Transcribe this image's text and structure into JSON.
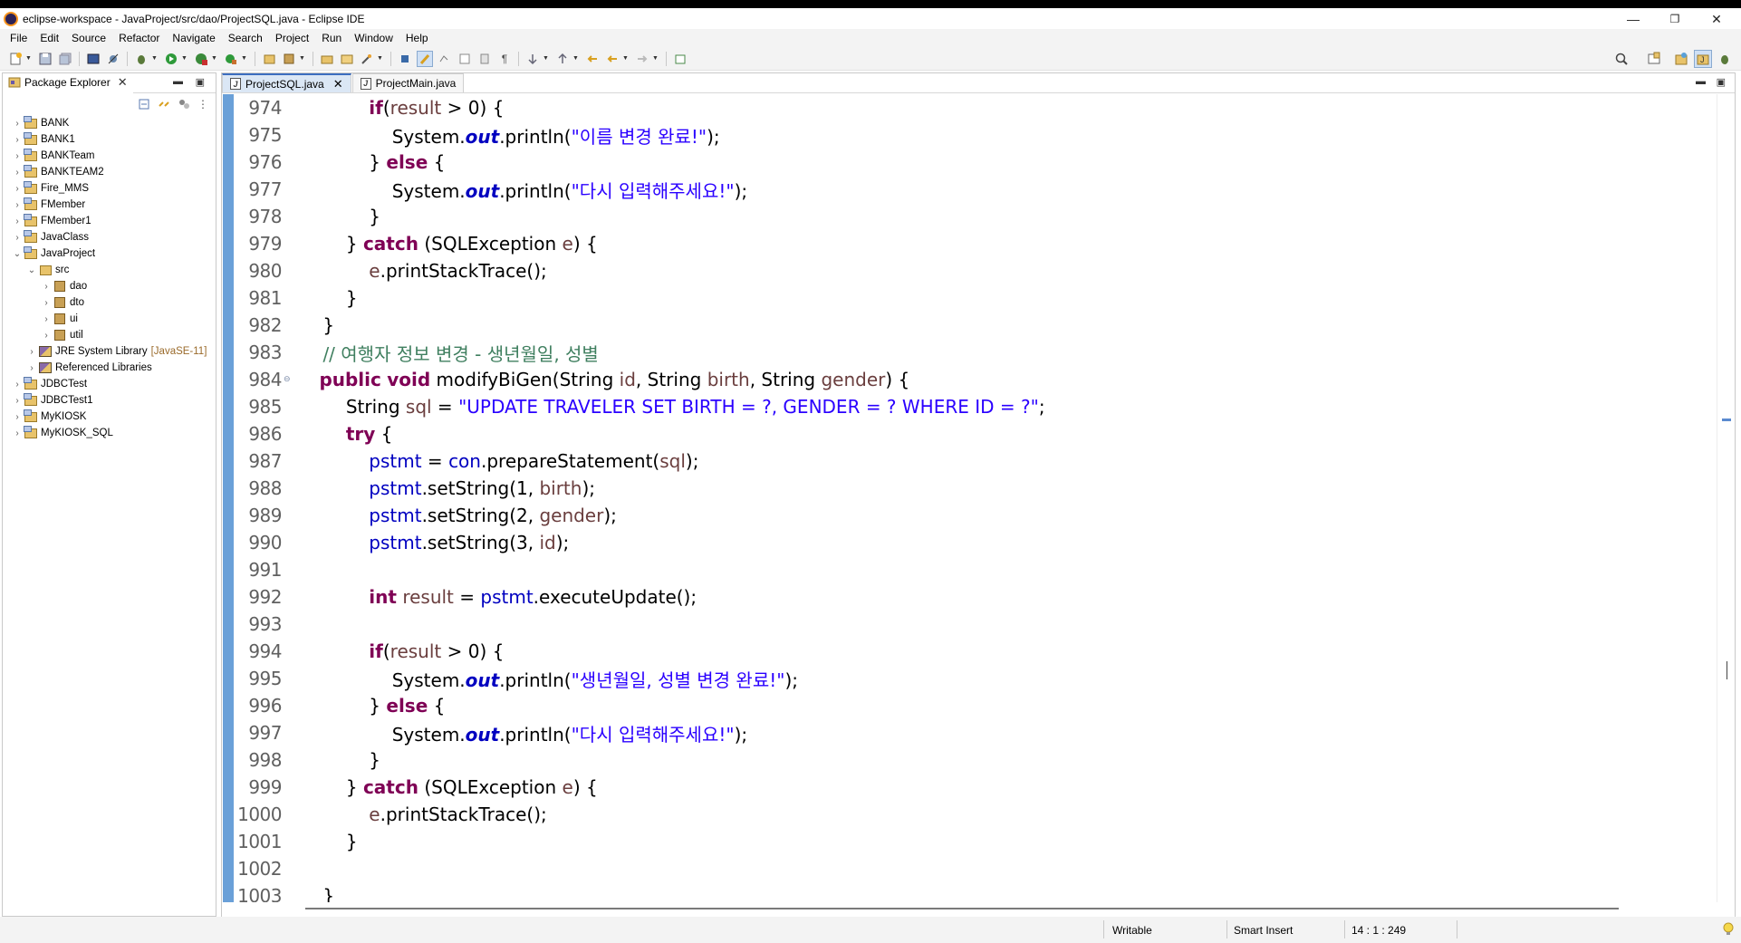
{
  "window": {
    "title": "eclipse-workspace - JavaProject/src/dao/ProjectSQL.java - Eclipse IDE",
    "min_glyph": "—",
    "restore_glyph": "❐",
    "close_glyph": "✕"
  },
  "menu": [
    "File",
    "Edit",
    "Source",
    "Refactor",
    "Navigate",
    "Search",
    "Project",
    "Run",
    "Window",
    "Help"
  ],
  "package_explorer": {
    "title": "Package Explorer",
    "items": [
      {
        "label": "BANK",
        "level": 0,
        "expanded": false,
        "kind": "project"
      },
      {
        "label": "BANK1",
        "level": 0,
        "expanded": false,
        "kind": "project"
      },
      {
        "label": "BANKTeam",
        "level": 0,
        "expanded": false,
        "kind": "project"
      },
      {
        "label": "BANKTEAM2",
        "level": 0,
        "expanded": false,
        "kind": "project"
      },
      {
        "label": "Fire_MMS",
        "level": 0,
        "expanded": false,
        "kind": "project"
      },
      {
        "label": "FMember",
        "level": 0,
        "expanded": false,
        "kind": "project"
      },
      {
        "label": "FMember1",
        "level": 0,
        "expanded": false,
        "kind": "project"
      },
      {
        "label": "JavaClass",
        "level": 0,
        "expanded": false,
        "kind": "project"
      },
      {
        "label": "JavaProject",
        "level": 0,
        "expanded": true,
        "kind": "project"
      },
      {
        "label": "src",
        "level": 1,
        "expanded": true,
        "kind": "src"
      },
      {
        "label": "dao",
        "level": 2,
        "expanded": false,
        "kind": "package"
      },
      {
        "label": "dto",
        "level": 2,
        "expanded": false,
        "kind": "package"
      },
      {
        "label": "ui",
        "level": 2,
        "expanded": false,
        "kind": "package"
      },
      {
        "label": "util",
        "level": 2,
        "expanded": false,
        "kind": "package"
      },
      {
        "label": "JRE System Library",
        "decoration": "[JavaSE-11]",
        "level": 1,
        "expanded": false,
        "kind": "library"
      },
      {
        "label": "Referenced Libraries",
        "level": 1,
        "expanded": false,
        "kind": "library"
      },
      {
        "label": "JDBCTest",
        "level": 0,
        "expanded": false,
        "kind": "project"
      },
      {
        "label": "JDBCTest1",
        "level": 0,
        "expanded": false,
        "kind": "project"
      },
      {
        "label": "MyKIOSK",
        "level": 0,
        "expanded": false,
        "kind": "project"
      },
      {
        "label": "MyKIOSK_SQL",
        "level": 0,
        "expanded": false,
        "kind": "project"
      }
    ]
  },
  "editor": {
    "tabs": [
      {
        "label": "ProjectSQL.java",
        "active": true
      },
      {
        "label": "ProjectMain.java",
        "active": false
      }
    ],
    "lines": [
      {
        "n": "974",
        "code": [
          [
            "",
            "            "
          ],
          [
            "k",
            "if"
          ],
          [
            "",
            "("
          ],
          [
            "v",
            "result"
          ],
          [
            "",
            " > 0) {"
          ]
        ]
      },
      {
        "n": "975",
        "code": [
          [
            "",
            "                System."
          ],
          [
            "f",
            "out"
          ],
          [
            "",
            ".println("
          ],
          [
            "s",
            "\"이름 변경 완료!\""
          ],
          [
            "",
            ");"
          ]
        ]
      },
      {
        "n": "976",
        "code": [
          [
            "",
            "            } "
          ],
          [
            "k",
            "else"
          ],
          [
            "",
            " {"
          ]
        ]
      },
      {
        "n": "977",
        "code": [
          [
            "",
            "                System."
          ],
          [
            "f",
            "out"
          ],
          [
            "",
            ".println("
          ],
          [
            "s",
            "\"다시 입력해주세요!\""
          ],
          [
            "",
            ");"
          ]
        ]
      },
      {
        "n": "978",
        "code": [
          [
            "",
            "            }"
          ]
        ]
      },
      {
        "n": "979",
        "code": [
          [
            "",
            "        } "
          ],
          [
            "k",
            "catch"
          ],
          [
            "",
            " (SQLException "
          ],
          [
            "v",
            "e"
          ],
          [
            "",
            ") {"
          ]
        ]
      },
      {
        "n": "980",
        "code": [
          [
            "",
            "            "
          ],
          [
            "v",
            "e"
          ],
          [
            "",
            ".printStackTrace();"
          ]
        ]
      },
      {
        "n": "981",
        "code": [
          [
            "",
            "        }"
          ]
        ]
      },
      {
        "n": "982",
        "code": [
          [
            "",
            "    }"
          ]
        ]
      },
      {
        "n": "983",
        "code": [
          [
            "",
            "    "
          ],
          [
            "c",
            "// 여행자 정보 변경 - 생년월일, 성별"
          ]
        ]
      },
      {
        "n": "984",
        "fold": true,
        "code": [
          [
            "",
            "    "
          ],
          [
            "k",
            "public"
          ],
          [
            "",
            " "
          ],
          [
            "k",
            "void"
          ],
          [
            "",
            " modifyBiGen(String "
          ],
          [
            "v",
            "id"
          ],
          [
            "",
            ", String "
          ],
          [
            "v",
            "birth"
          ],
          [
            "",
            ", String "
          ],
          [
            "v",
            "gender"
          ],
          [
            "",
            ") {"
          ]
        ]
      },
      {
        "n": "985",
        "code": [
          [
            "",
            "        String "
          ],
          [
            "v",
            "sql"
          ],
          [
            "",
            " = "
          ],
          [
            "s",
            "\"UPDATE TRAVELER SET BIRTH = ?, GENDER = ? WHERE ID = ?\""
          ],
          [
            "",
            ";"
          ]
        ]
      },
      {
        "n": "986",
        "code": [
          [
            "",
            "        "
          ],
          [
            "k",
            "try"
          ],
          [
            "",
            " {"
          ]
        ]
      },
      {
        "n": "987",
        "code": [
          [
            "",
            "            "
          ],
          [
            "fd",
            "pstmt"
          ],
          [
            "",
            " = "
          ],
          [
            "fd",
            "con"
          ],
          [
            "",
            ".prepareStatement("
          ],
          [
            "v",
            "sql"
          ],
          [
            "",
            ");"
          ]
        ]
      },
      {
        "n": "988",
        "code": [
          [
            "",
            "            "
          ],
          [
            "fd",
            "pstmt"
          ],
          [
            "",
            ".setString(1, "
          ],
          [
            "v",
            "birth"
          ],
          [
            "",
            ");"
          ]
        ]
      },
      {
        "n": "989",
        "code": [
          [
            "",
            "            "
          ],
          [
            "fd",
            "pstmt"
          ],
          [
            "",
            ".setString(2, "
          ],
          [
            "v",
            "gender"
          ],
          [
            "",
            ");"
          ]
        ]
      },
      {
        "n": "990",
        "code": [
          [
            "",
            "            "
          ],
          [
            "fd",
            "pstmt"
          ],
          [
            "",
            ".setString(3, "
          ],
          [
            "v",
            "id"
          ],
          [
            "",
            ");"
          ]
        ]
      },
      {
        "n": "991",
        "code": [
          [
            "",
            ""
          ]
        ]
      },
      {
        "n": "992",
        "code": [
          [
            "",
            "            "
          ],
          [
            "k",
            "int"
          ],
          [
            "",
            " "
          ],
          [
            "v",
            "result"
          ],
          [
            "",
            " = "
          ],
          [
            "fd",
            "pstmt"
          ],
          [
            "",
            ".executeUpdate();"
          ]
        ]
      },
      {
        "n": "993",
        "code": [
          [
            "",
            ""
          ]
        ]
      },
      {
        "n": "994",
        "code": [
          [
            "",
            "            "
          ],
          [
            "k",
            "if"
          ],
          [
            "",
            "("
          ],
          [
            "v",
            "result"
          ],
          [
            "",
            " > 0) {"
          ]
        ]
      },
      {
        "n": "995",
        "code": [
          [
            "",
            "                System."
          ],
          [
            "f",
            "out"
          ],
          [
            "",
            ".println("
          ],
          [
            "s",
            "\"생년월일, 성별 변경 완료!\""
          ],
          [
            "",
            ");"
          ]
        ]
      },
      {
        "n": "996",
        "code": [
          [
            "",
            "            } "
          ],
          [
            "k",
            "else"
          ],
          [
            "",
            " {"
          ]
        ]
      },
      {
        "n": "997",
        "code": [
          [
            "",
            "                System."
          ],
          [
            "f",
            "out"
          ],
          [
            "",
            ".println("
          ],
          [
            "s",
            "\"다시 입력해주세요!\""
          ],
          [
            "",
            ");"
          ]
        ]
      },
      {
        "n": "998",
        "code": [
          [
            "",
            "            }"
          ]
        ]
      },
      {
        "n": "999",
        "code": [
          [
            "",
            "        } "
          ],
          [
            "k",
            "catch"
          ],
          [
            "",
            " (SQLException "
          ],
          [
            "v",
            "e"
          ],
          [
            "",
            ") {"
          ]
        ]
      },
      {
        "n": "1000",
        "code": [
          [
            "",
            "            "
          ],
          [
            "v",
            "e"
          ],
          [
            "",
            ".printStackTrace();"
          ]
        ]
      },
      {
        "n": "1001",
        "code": [
          [
            "",
            "        }"
          ]
        ]
      },
      {
        "n": "1002",
        "code": [
          [
            "",
            ""
          ]
        ]
      },
      {
        "n": "1003",
        "code": [
          [
            "",
            "    }"
          ]
        ]
      }
    ]
  },
  "status": {
    "writable": "Writable",
    "insert_mode": "Smart Insert",
    "position": "14 : 1 : 249"
  }
}
